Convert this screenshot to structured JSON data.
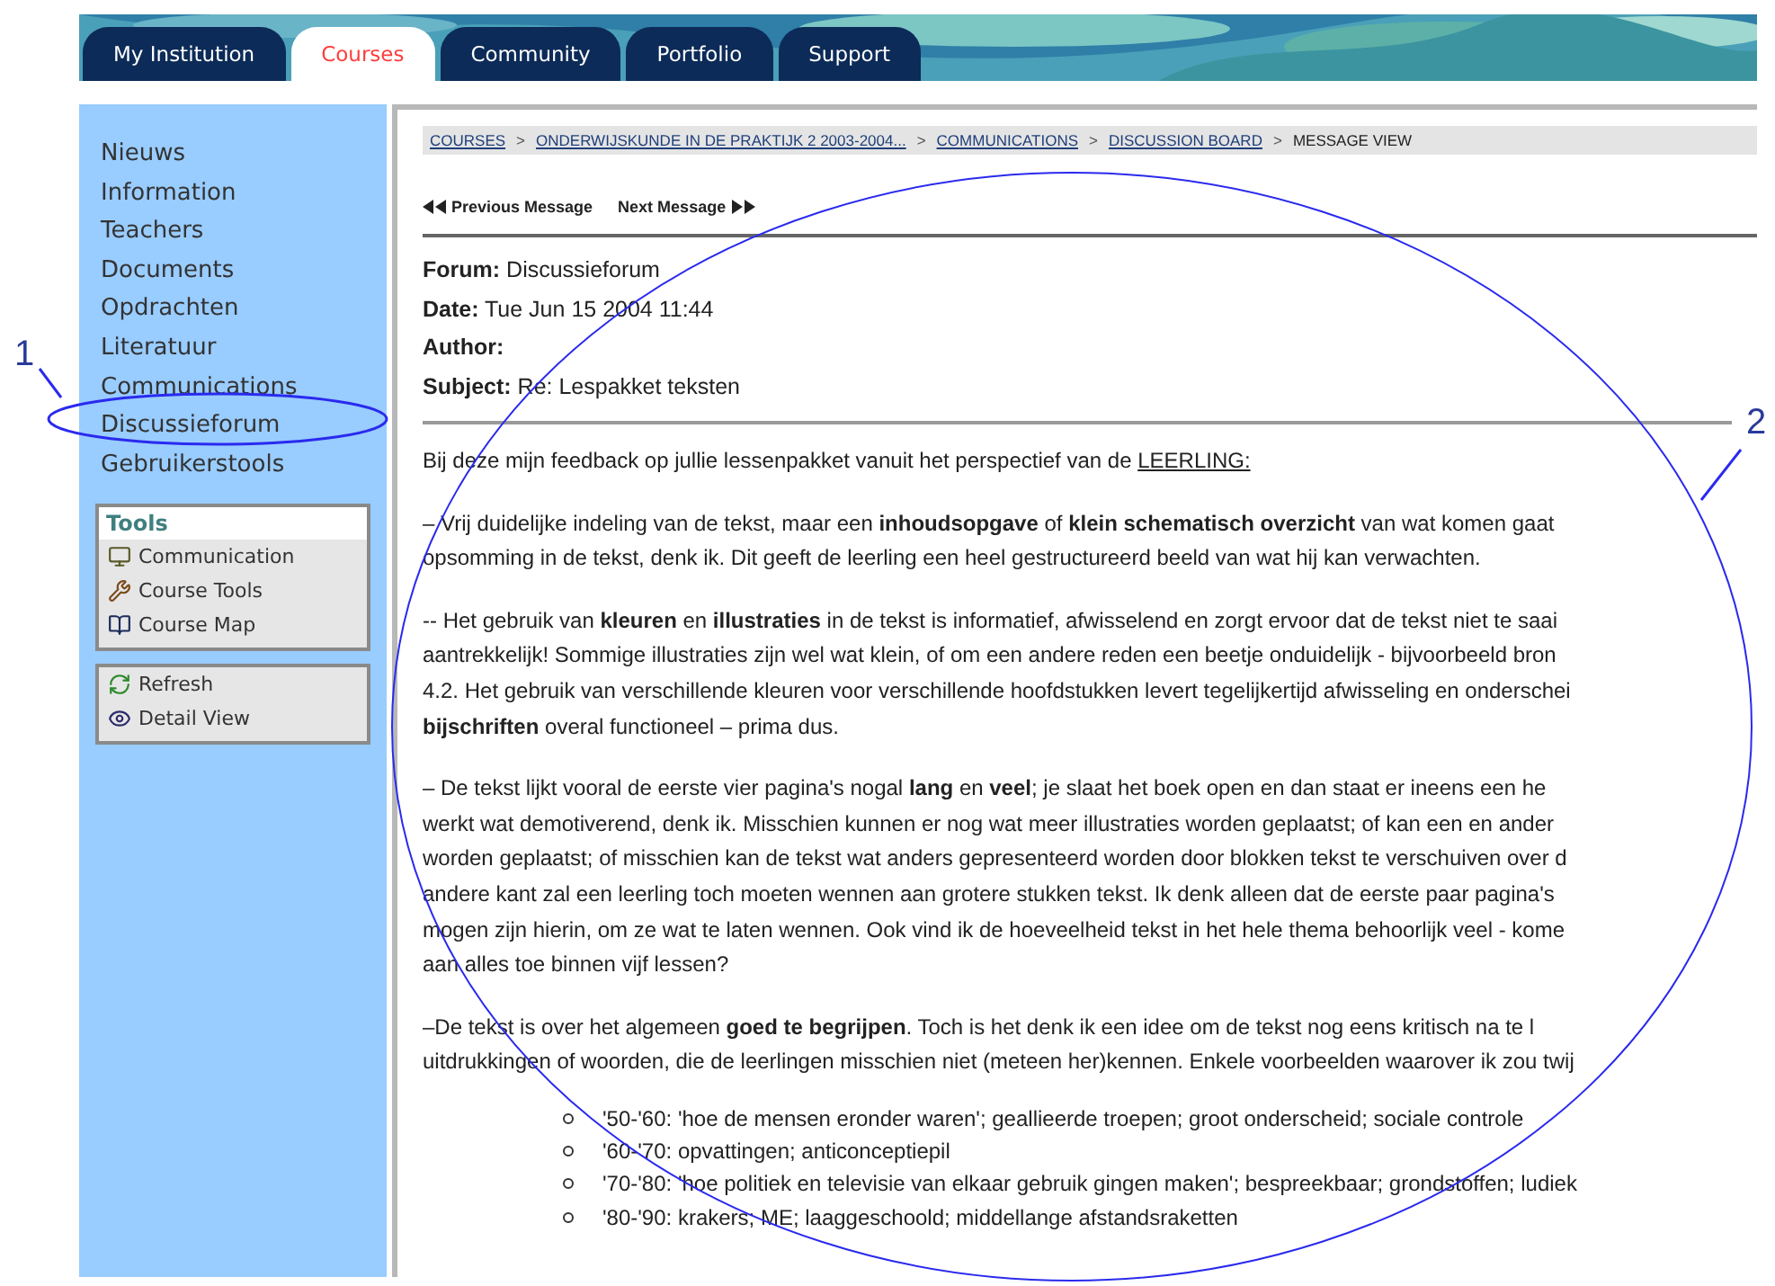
{
  "tabs": [
    {
      "label": "My Institution",
      "selected": false
    },
    {
      "label": "Courses",
      "selected": true
    },
    {
      "label": "Community",
      "selected": false
    },
    {
      "label": "Portfolio",
      "selected": false
    },
    {
      "label": "Support",
      "selected": false
    }
  ],
  "sidebar": {
    "items": [
      {
        "label": "Nieuws"
      },
      {
        "label": "Information"
      },
      {
        "label": "Teachers"
      },
      {
        "label": "Documents"
      },
      {
        "label": "Opdrachten"
      },
      {
        "label": "Literatuur"
      },
      {
        "label": "Communications"
      },
      {
        "label": "Discussieforum"
      },
      {
        "label": "Gebruikerstools"
      }
    ],
    "tools": {
      "title": "Tools",
      "items": [
        {
          "label": "Communication",
          "kind": "monitor"
        },
        {
          "label": "Course Tools",
          "kind": "tools"
        },
        {
          "label": "Course Map",
          "kind": "map"
        }
      ]
    },
    "actions": [
      {
        "label": "Refresh",
        "kind": "refresh"
      },
      {
        "label": "Detail View",
        "kind": "detail"
      }
    ]
  },
  "breadcrumb": [
    {
      "label": "COURSES",
      "link": true
    },
    {
      "separator": ">",
      "label": "ONDERWIJSKUNDE IN DE PRAKTIJK 2 2003-2004...",
      "link": true
    },
    {
      "separator": ">",
      "label": "COMMUNICATIONS",
      "link": true
    },
    {
      "separator": ">",
      "label": "DISCUSSION BOARD",
      "link": true
    },
    {
      "separator": ">",
      "label": "MESSAGE VIEW",
      "link": false
    }
  ],
  "message_nav": {
    "previous": "Previous Message",
    "next": "Next Message"
  },
  "meta": [
    {
      "label": "Forum:",
      "value": "Discussieforum"
    },
    {
      "label": "Date:",
      "value": "Tue Jun 15 2004 11:44"
    },
    {
      "label": "Author:"
    },
    {
      "label": "Subject:",
      "value": "Re: Lespakket teksten"
    }
  ],
  "body": [
    {
      "lines": [
        {
          "text": "Bij deze mijn feedback op jullie lessenpakket vanuit het perspectief van de",
          "underlined": "LEERLING:"
        }
      ]
    },
    {
      "lines": [
        {
          "text": "– Vrij duidelijke indeling van de tekst, maar een **inhoudsopgave** of **klein schematisch overzicht** van wat komen gaat"
        },
        {
          "text": "opsomming in de tekst, denk ik. Dit geeft de leerling een heel gestructureerd beeld van wat hij kan verwachten."
        }
      ]
    },
    {
      "lines": [
        {
          "text": "-- Het gebruik van **kleuren** en **illustraties** in de tekst is informatief, afwisselend en zorgt ervoor dat de tekst niet te saai"
        },
        {
          "text": "aantrekkelijk! Sommige illustraties zijn wel wat klein, of om een andere reden een beetje onduidelijk - bijvoorbeeld bron"
        },
        {
          "text": "4.2. Het gebruik van verschillende kleuren voor verschillende hoofdstukken levert tegelijkertijd afwisseling en onderschei"
        },
        {
          "text": "**bijschriften** overal functioneel – prima dus."
        }
      ]
    },
    {
      "lines": [
        {
          "text": "– De tekst lijkt vooral de eerste vier pagina's nogal **lang** en **veel**; je slaat het boek open en dan staat er ineens een he"
        },
        {
          "text": "werkt wat demotiverend, denk ik. Misschien kunnen er nog wat meer illustraties worden geplaatst; of kan een en ander"
        },
        {
          "text": "worden geplaatst; of misschien kan de tekst wat anders gepresenteerd worden door blokken tekst te verschuiven over d"
        },
        {
          "text": "andere kant zal een leerling toch moeten wennen aan grotere stukken tekst. Ik denk alleen dat de eerste paar pagina's"
        },
        {
          "text": "mogen zijn hierin, om ze wat te laten wennen. Ook vind ik de hoeveelheid tekst in het hele thema behoorlijk veel - kome"
        },
        {
          "text": "aan alles toe binnen vijf lessen?"
        }
      ]
    },
    {
      "lines": [
        {
          "text": "–De tekst is over het algemeen **goed te begrijpen**. Toch is het denk ik een idee om de tekst nog eens kritisch na te l"
        },
        {
          "text": "uitdrukkingen of woorden, die de leerlingen misschien niet (meteen her)kennen. Enkele voorbeelden waarover ik zou twij"
        }
      ]
    }
  ],
  "list": [
    "'50-'60: 'hoe de mensen eronder waren'; geallieerde troepen; groot onderscheid; sociale controle",
    "'60-'70: opvattingen; anticonceptiepil",
    "'70-'80: 'hoe politiek en televisie van elkaar gebruik gingen maken'; bespreekbaar; grondstoffen; ludiek",
    "'80-'90: krakers; ME; laaggeschoold; middellange afstandsraketten"
  ],
  "annotations": [
    {
      "label": "1"
    },
    {
      "label": "2"
    }
  ]
}
